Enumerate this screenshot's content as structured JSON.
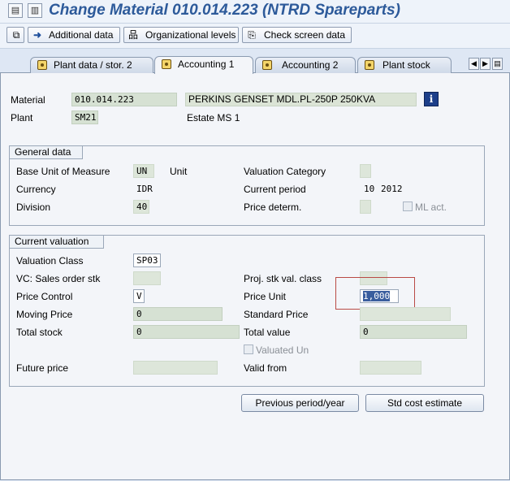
{
  "title": "Change Material 010.014.223 (NTRD Spareparts)",
  "toolbar": {
    "additional_data": "Additional data",
    "organizational_levels": "Organizational levels",
    "check_screen_data": "Check screen data"
  },
  "tabs": [
    {
      "label": "Plant data / stor. 2",
      "active": false
    },
    {
      "label": "Accounting 1",
      "active": true
    },
    {
      "label": "Accounting 2",
      "active": false
    },
    {
      "label": "Plant stock",
      "active": false
    }
  ],
  "header": {
    "material_label": "Material",
    "material_value": "010.014.223",
    "material_desc": "PERKINS GENSET MDL.PL-250P 250KVA",
    "plant_label": "Plant",
    "plant_value": "SM21",
    "plant_desc": "Estate MS 1"
  },
  "general_data": {
    "title": "General data",
    "base_uom_label": "Base Unit of Measure",
    "base_uom_value": "UN",
    "base_uom_text": "Unit",
    "currency_label": "Currency",
    "currency_value": "IDR",
    "division_label": "Division",
    "division_value": "40",
    "valuation_category_label": "Valuation Category",
    "valuation_category_value": "",
    "current_period_label": "Current period",
    "current_period_month": "10",
    "current_period_year": "2012",
    "price_determ_label": "Price determ.",
    "price_determ_value": "",
    "ml_act_label": "ML act.",
    "ml_act_checked": false
  },
  "current_valuation": {
    "title": "Current valuation",
    "valuation_class_label": "Valuation Class",
    "valuation_class_value": "SP03",
    "vc_sales_order_label": "VC: Sales order stk",
    "vc_sales_order_value": "",
    "proj_stk_label": "Proj. stk val. class",
    "proj_stk_value": "",
    "price_control_label": "Price Control",
    "price_control_value": "V",
    "price_unit_label": "Price Unit",
    "price_unit_value": "1,000",
    "moving_price_label": "Moving Price",
    "moving_price_value": "0",
    "standard_price_label": "Standard Price",
    "standard_price_value": "",
    "total_stock_label": "Total stock",
    "total_stock_value": "0",
    "total_value_label": "Total value",
    "total_value_value": "0",
    "valuated_un_label": "Valuated Un",
    "valuated_un_checked": false,
    "future_price_label": "Future price",
    "future_price_value": "",
    "valid_from_label": "Valid from",
    "valid_from_value": ""
  },
  "buttons": {
    "previous_period": "Previous period/year",
    "std_cost_estimate": "Std cost estimate"
  },
  "colors": {
    "title": "#2d5a9a",
    "background": "#dee7f4",
    "display_field": "#d6e1d3",
    "highlight": "#b94a45"
  }
}
